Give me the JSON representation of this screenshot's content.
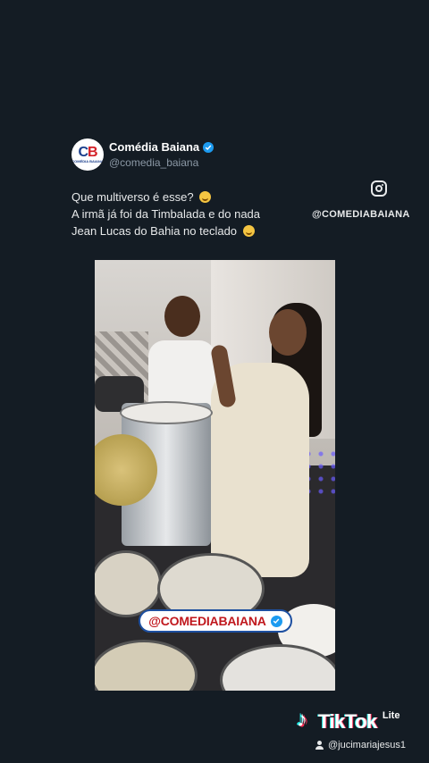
{
  "profile": {
    "avatar_letters": [
      "C",
      "B"
    ],
    "avatar_caption": "COMÉDIA BAIANA",
    "name": "Comédia Baiana",
    "handle": "@comedia_baiana",
    "verified_icon": "verified-badge-icon"
  },
  "tweet": {
    "lines": [
      "Que multiverso é esse?",
      "A irmã já foi da Timbalada e do nada",
      " Jean Lucas do Bahia no teclado"
    ],
    "emoji": "grinning-sweat-emoji"
  },
  "instagram": {
    "icon": "instagram-icon",
    "handle": "@COMEDIABAIANA"
  },
  "video": {
    "watermark": "@COMEDIABAIANA"
  },
  "tiktok": {
    "brand": "TikTok",
    "tier": "Lite",
    "username": "@jucimariajesus1",
    "icon": "tiktok-logo-icon"
  },
  "colors": {
    "background": "#141c24",
    "verified": "#1d9bf0",
    "brand_red": "#c0171d",
    "brand_blue": "#1d4fa0"
  }
}
